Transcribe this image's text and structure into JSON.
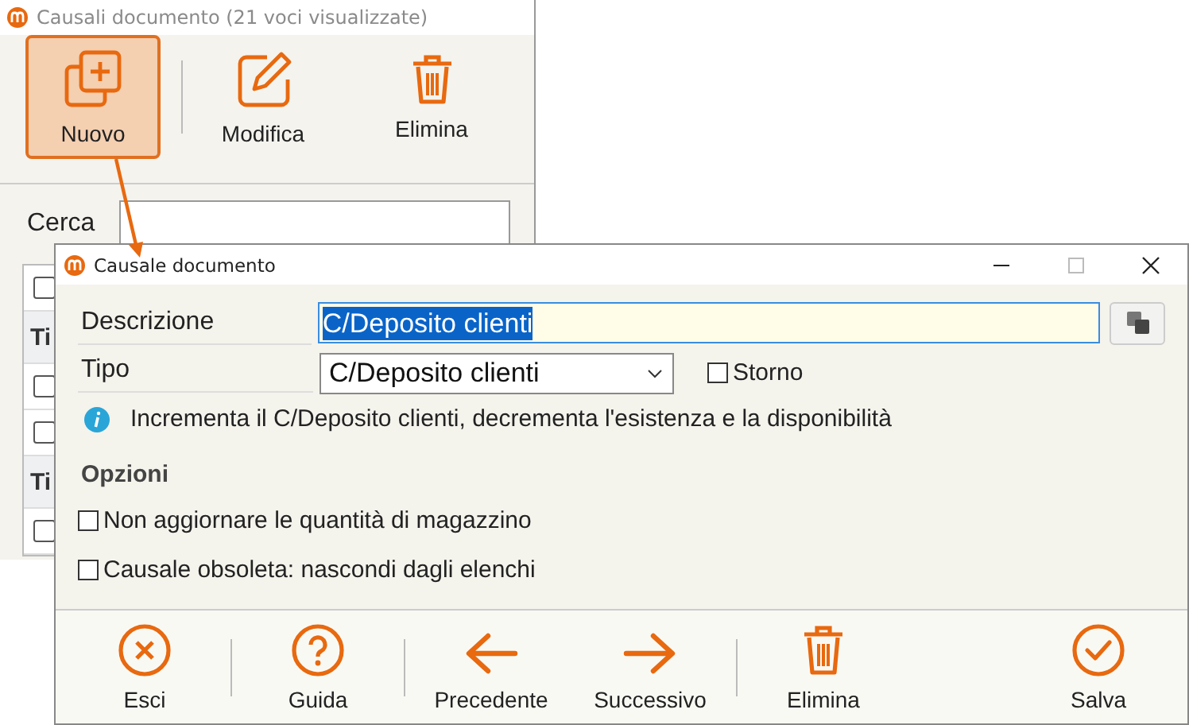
{
  "background_window": {
    "title": "Causali documento (21 voci visualizzate)",
    "toolbar": [
      {
        "label": "Nuovo",
        "selected": true
      },
      {
        "label": "Modifica",
        "selected": false
      },
      {
        "label": "Elimina",
        "selected": false
      }
    ],
    "search": {
      "label": "Cerca"
    },
    "list_rows": [
      {
        "kind": "check",
        "checked": false
      },
      {
        "kind": "group",
        "text": "Ti"
      },
      {
        "kind": "check",
        "checked": false
      },
      {
        "kind": "check",
        "checked": false
      },
      {
        "kind": "group",
        "text": "Ti"
      },
      {
        "kind": "check",
        "checked": false
      }
    ]
  },
  "dialog": {
    "title": "Causale documento",
    "descrizione": {
      "label": "Descrizione",
      "value": "C/Deposito clienti"
    },
    "tipo": {
      "label": "Tipo",
      "value": "C/Deposito clienti"
    },
    "storno": {
      "label": "Storno",
      "checked": false
    },
    "info": "Incrementa il C/Deposito clienti, decrementa l'esistenza e la disponibilità",
    "options_title": "Opzioni",
    "options": [
      {
        "label": "Non aggiornare le quantità di magazzino",
        "checked": false
      },
      {
        "label": "Causale obsoleta: nascondi dagli elenchi",
        "checked": false
      }
    ],
    "button_groups": [
      [
        {
          "label": "Esci"
        }
      ],
      [
        {
          "label": "Guida"
        }
      ],
      [
        {
          "label": "Precedente"
        },
        {
          "label": "Successivo"
        }
      ],
      [
        {
          "label": "Elimina"
        }
      ],
      [
        {
          "label": "Salva"
        }
      ]
    ]
  }
}
